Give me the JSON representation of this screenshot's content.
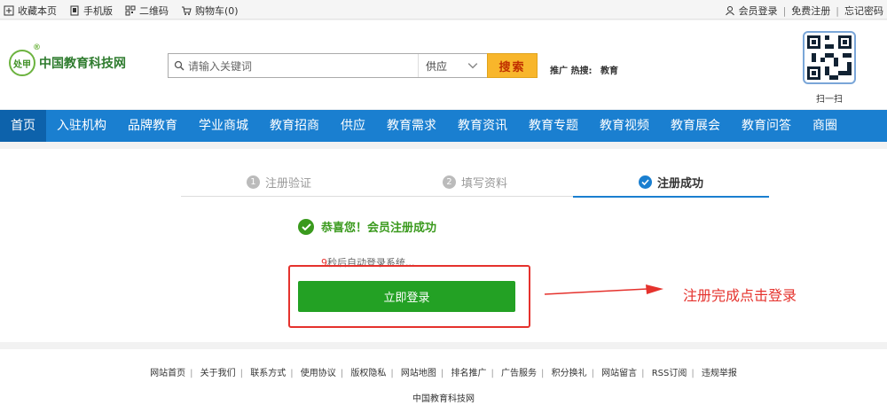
{
  "topbar": {
    "left": [
      {
        "label": "收藏本页",
        "icon": "bookmark-icon"
      },
      {
        "label": "手机版",
        "icon": "mobile-icon"
      },
      {
        "label": "二维码",
        "icon": "qrcode-icon"
      },
      {
        "label": "购物车(0)",
        "icon": "cart-icon"
      }
    ],
    "right": [
      {
        "label": "会员登录",
        "icon": "user-icon"
      },
      {
        "label": "免费注册"
      },
      {
        "label": "忘记密码"
      }
    ],
    "separator": "|"
  },
  "header": {
    "logo_badge": "处甲",
    "logo_registered": "®",
    "logo_text": "中国教育科技网",
    "search_placeholder": "请输入关键词",
    "search_category": "供应",
    "search_button": "搜索",
    "hot_label": "推广 热搜:",
    "hot_keyword": "教育",
    "qr_label": "扫一扫"
  },
  "nav": {
    "items": [
      "首页",
      "入驻机构",
      "品牌教育",
      "学业商城",
      "教育招商",
      "供应",
      "教育需求",
      "教育资讯",
      "教育专题",
      "教育视频",
      "教育展会",
      "教育问答",
      "商圈"
    ],
    "active_index": 0
  },
  "steps": [
    {
      "num": "1",
      "label": "注册验证",
      "state": "inactive"
    },
    {
      "num": "2",
      "label": "填写资料",
      "state": "inactive"
    },
    {
      "num": "",
      "label": "注册成功",
      "state": "done"
    }
  ],
  "result": {
    "message": "恭喜您！会员注册成功",
    "countdown_num": "9",
    "countdown_text": "秒后自动登录系统...",
    "login_button": "立即登录",
    "annotation": "注册完成点击登录"
  },
  "footer": {
    "links": [
      "网站首页",
      "关于我们",
      "联系方式",
      "使用协议",
      "版权隐私",
      "网站地图",
      "排名推广",
      "广告服务",
      "积分换礼",
      "网站留言",
      "RSS订阅",
      "违规举报"
    ],
    "copyright": "中国教育科技网"
  },
  "colors": {
    "nav_bg": "#1a7fd0",
    "nav_active": "#0d62ab",
    "success_green": "#3a9a1d",
    "login_button": "#23a124",
    "highlight_red": "#e5322d",
    "search_button": "#f8b62b"
  }
}
